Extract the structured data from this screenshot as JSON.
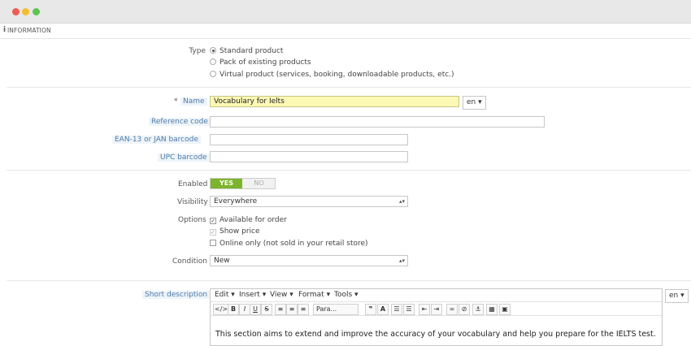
{
  "window": {
    "title_dots": [
      "close",
      "minimize",
      "maximize"
    ]
  },
  "panel": {
    "icon": "info-icon",
    "heading": "INFORMATION"
  },
  "type": {
    "label": "Type",
    "options": [
      "Standard product",
      "Pack of existing products",
      "Virtual product (services, booking, downloadable products, etc.)"
    ],
    "selected": "Standard product"
  },
  "name": {
    "required_mark": "*",
    "label": "Name",
    "value": "Vocabulary for Ielts",
    "lang": "en"
  },
  "reference": {
    "label": "Reference code",
    "value": ""
  },
  "ean": {
    "label": "EAN-13 or JAN barcode",
    "value": ""
  },
  "upc": {
    "label": "UPC barcode",
    "value": ""
  },
  "enabled": {
    "label": "Enabled",
    "yes": "YES",
    "no": "NO",
    "state": "YES"
  },
  "visibility": {
    "label": "Visibility",
    "value": "Everywhere"
  },
  "options": {
    "label": "Options",
    "items": [
      {
        "label": "Available for order",
        "checked": true
      },
      {
        "label": "Show price",
        "checked": true
      },
      {
        "label": "Online only (not sold in your retail store)",
        "checked": false
      }
    ]
  },
  "condition": {
    "label": "Condition",
    "value": "New"
  },
  "short_description": {
    "label": "Short description",
    "lang": "en",
    "menus": [
      "Edit",
      "Insert",
      "View",
      "Format",
      "Tools"
    ],
    "format_select": "Para...",
    "content": "This section aims to extend and improve the accuracy of your vocabulary and help you prepare for the IELTS test."
  },
  "colors": {
    "accent_blue": "#4c7ba9",
    "toggle_green": "#7cb42c",
    "highlight_yellow": "#fcf9b4",
    "required_red": "#e0412d"
  }
}
